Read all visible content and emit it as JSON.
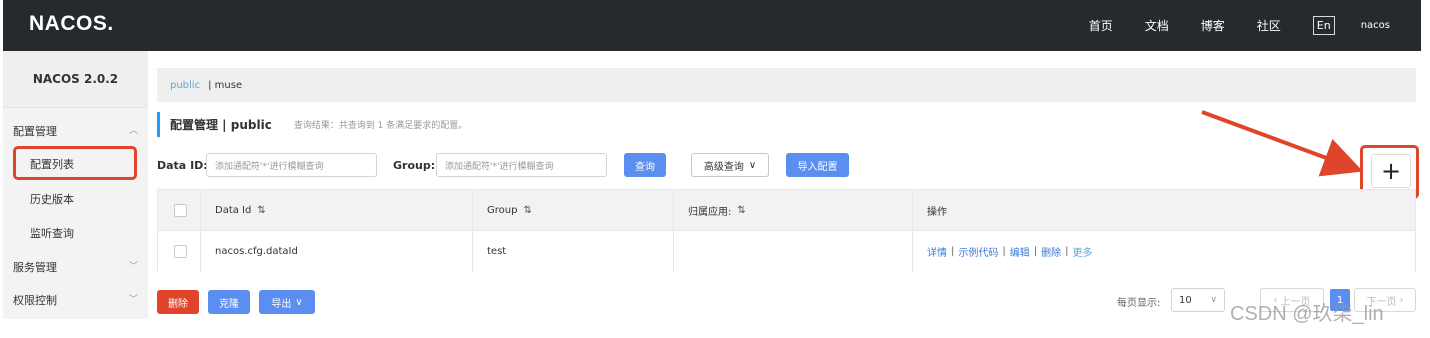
{
  "topbar": {
    "logo": "NACOS.",
    "nav": [
      "首页",
      "文档",
      "博客",
      "社区"
    ],
    "lang": "En",
    "user": "nacos"
  },
  "sidebar": {
    "version": "NACOS 2.0.2",
    "config_mgmt": "配置管理",
    "config_list": "配置列表",
    "history": "历史版本",
    "listen_query": "监听查询",
    "service_mgmt": "服务管理",
    "permission": "权限控制"
  },
  "breadcrumb": {
    "namespace": "public",
    "other": "| muse"
  },
  "heading": {
    "title": "配置管理 | public",
    "result": "查询结果：共查询到 1 条满足要求的配置。"
  },
  "search": {
    "data_id_label": "Data ID:",
    "data_id_placeholder": "添加通配符'*'进行模糊查询",
    "group_label": "Group:",
    "group_placeholder": "添加通配符'*'进行模糊查询",
    "query_btn": "查询",
    "advanced_btn": "高级查询",
    "import_btn": "导入配置"
  },
  "table": {
    "headers": [
      "Data Id",
      "Group",
      "归属应用:",
      "操作"
    ],
    "rows": [
      {
        "data_id": "nacos.cfg.dataId",
        "group": "test",
        "app": "",
        "ops": [
          "详情",
          "示例代码",
          "编辑",
          "删除"
        ],
        "more": "更多"
      }
    ]
  },
  "actions": {
    "delete": "删除",
    "clone": "克隆",
    "export": "导出"
  },
  "pagination": {
    "per_page_label": "每页显示:",
    "per_page_value": "10",
    "prev": "上一页",
    "current": "1",
    "next": "下一页"
  },
  "plus_symbol": "+",
  "watermark": "CSDN @玖柒_lin",
  "colors": {
    "topbar": "#252a2f",
    "primary": "#5b8ef0",
    "danger": "#e0442b",
    "highlight": "#e0442b",
    "link": "#3b7ad6"
  }
}
